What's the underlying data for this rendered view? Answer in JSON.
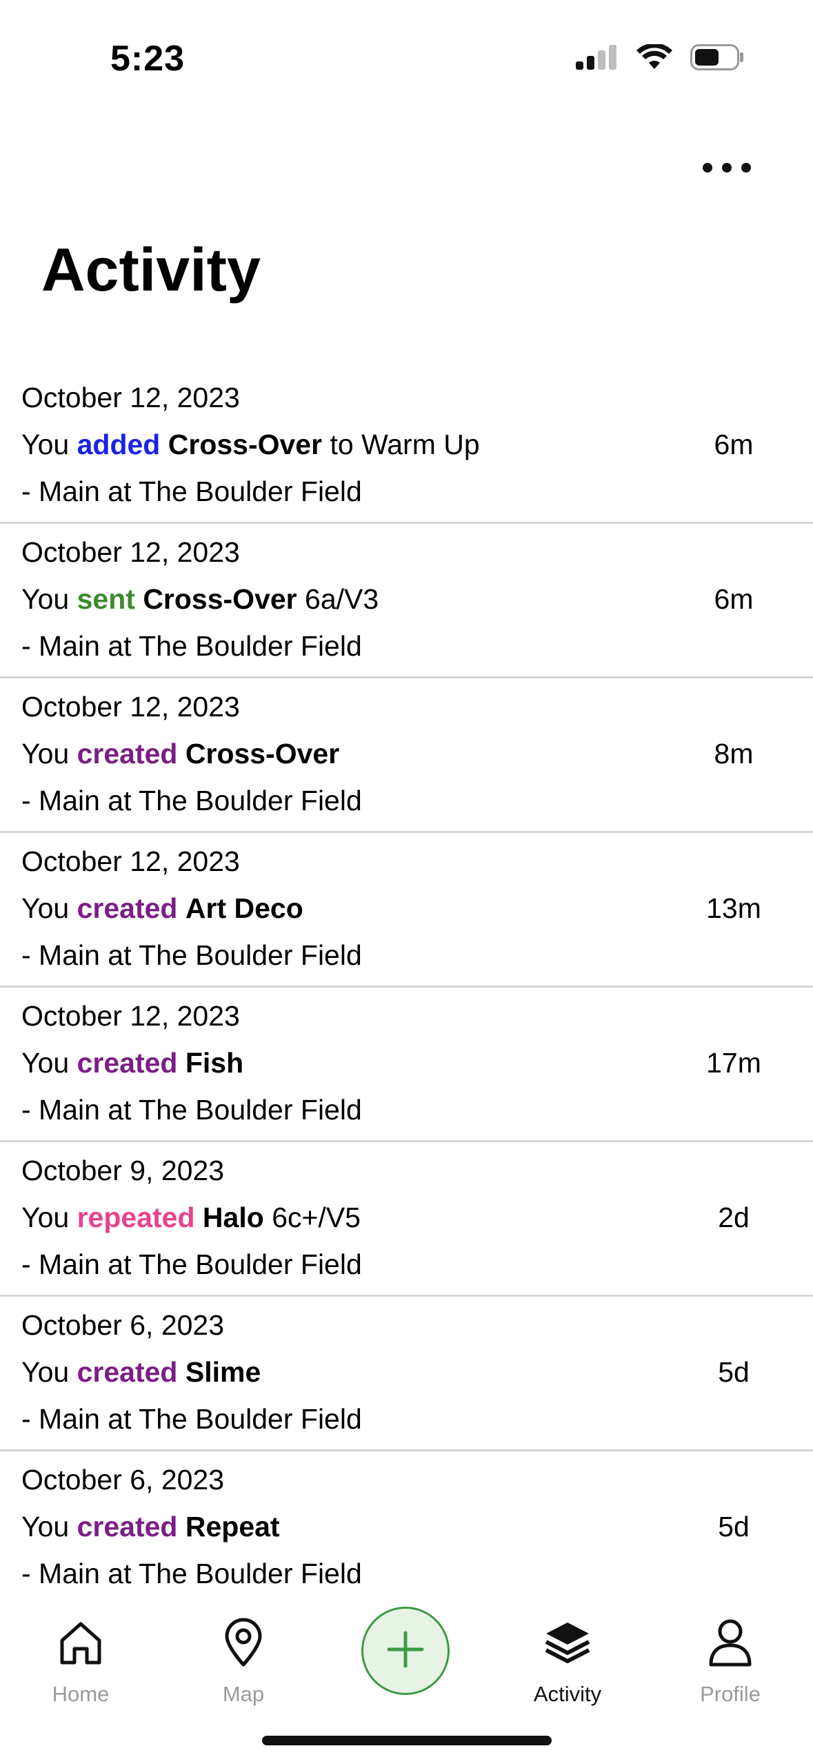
{
  "status_bar": {
    "time": "5:23"
  },
  "header": {
    "title": "Activity",
    "more_icon": "ellipsis-icon"
  },
  "activities": [
    {
      "date": "October 12, 2023",
      "prefix": "You",
      "action": "added",
      "action_type": "added",
      "route": "Cross-Over",
      "suffix": "to Warm Up",
      "location": "- Main at The Boulder Field",
      "ago": "6m"
    },
    {
      "date": "October 12, 2023",
      "prefix": "You",
      "action": "sent",
      "action_type": "sent",
      "route": "Cross-Over",
      "suffix": "6a/V3",
      "location": "- Main at The Boulder Field",
      "ago": "6m"
    },
    {
      "date": "October 12, 2023",
      "prefix": "You",
      "action": "created",
      "action_type": "created",
      "route": "Cross-Over",
      "suffix": "",
      "location": "- Main at The Boulder Field",
      "ago": "8m"
    },
    {
      "date": "October 12, 2023",
      "prefix": "You",
      "action": "created",
      "action_type": "created",
      "route": "Art Deco",
      "suffix": "",
      "location": "- Main at The Boulder Field",
      "ago": "13m"
    },
    {
      "date": "October 12, 2023",
      "prefix": "You",
      "action": "created",
      "action_type": "created",
      "route": "Fish",
      "suffix": "",
      "location": "- Main at The Boulder Field",
      "ago": "17m"
    },
    {
      "date": "October 9, 2023",
      "prefix": "You",
      "action": "repeated",
      "action_type": "repeated",
      "route": "Halo",
      "suffix": "6c+/V5",
      "location": "- Main at The Boulder Field",
      "ago": "2d"
    },
    {
      "date": "October 6, 2023",
      "prefix": "You",
      "action": "created",
      "action_type": "created",
      "route": "Slime",
      "suffix": "",
      "location": "- Main at The Boulder Field",
      "ago": "5d"
    },
    {
      "date": "October 6, 2023",
      "prefix": "You",
      "action": "created",
      "action_type": "created",
      "route": "Repeat",
      "suffix": "",
      "location": "- Main at The Boulder Field",
      "ago": "5d"
    }
  ],
  "action_colors": {
    "added": "#1a23e6",
    "sent": "#3c8a2e",
    "created": "#7b1e85",
    "repeated": "#e8428f"
  },
  "tab_bar": {
    "home": {
      "label": "Home",
      "icon": "home-icon"
    },
    "map": {
      "label": "Map",
      "icon": "map-pin-icon"
    },
    "add": {
      "icon": "plus-icon"
    },
    "activity": {
      "label": "Activity",
      "icon": "layers-icon",
      "active": true
    },
    "profile": {
      "label": "Profile",
      "icon": "user-icon"
    }
  }
}
